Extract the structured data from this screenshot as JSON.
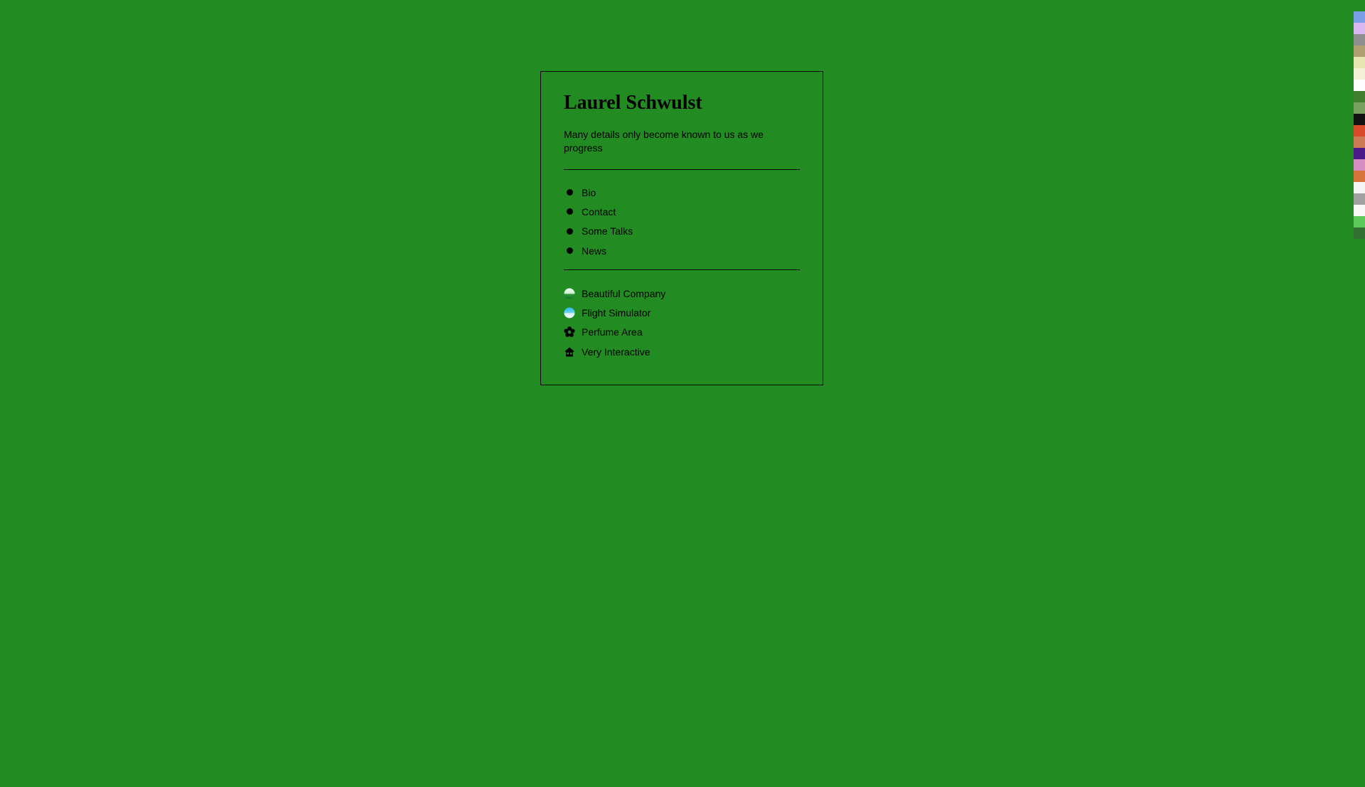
{
  "profile": {
    "name": "Laurel Schwulst",
    "tagline": "Many details only become known to us as we progress"
  },
  "nav": {
    "items": [
      {
        "label": "Bio"
      },
      {
        "label": "Contact"
      },
      {
        "label": "Some Talks"
      },
      {
        "label": "News"
      }
    ]
  },
  "projects": {
    "items": [
      {
        "label": "Beautiful Company",
        "icon": "green-sphere-icon"
      },
      {
        "label": "Flight Simulator",
        "icon": "blue-sphere-icon"
      },
      {
        "label": "Perfume Area",
        "icon": "flower-icon"
      },
      {
        "label": "Very Interactive",
        "icon": "house-icon"
      }
    ]
  },
  "theme": {
    "background": "#228b22",
    "text": "#000000"
  },
  "side_swatches": [
    "#7b9fe6",
    "#d9b8f0",
    "#8e8e8e",
    "#b0a070",
    "#e8e6b0",
    "#f3f0d6",
    "#ffffff",
    "#3f7f2f",
    "#7aa060",
    "#111111",
    "#d94a2a",
    "#cc7a52",
    "#4b1a8a",
    "#d58cc0",
    "#d6743a",
    "#f5f5f5",
    "#a0a0a0",
    "#f8f8f8",
    "#5ac85a",
    "#2f6f2f"
  ]
}
